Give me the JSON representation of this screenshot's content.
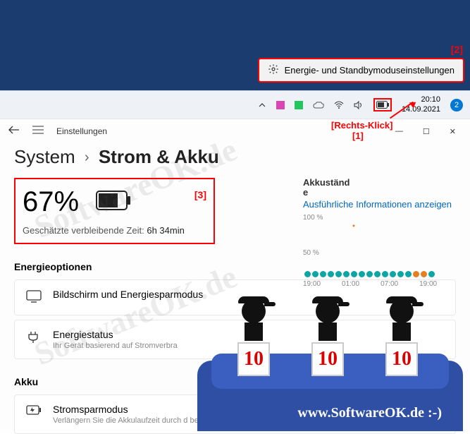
{
  "annotations": {
    "two": "[2]",
    "rightclick": "[Rechts-Klick]",
    "one": "[1]",
    "three": "[3]"
  },
  "context_menu": {
    "label": "Energie- und Standbymoduseinstellungen"
  },
  "taskbar": {
    "time": "20:10",
    "date": "14.09.2021",
    "badge": "2"
  },
  "settings": {
    "app_name": "Einstellungen",
    "breadcrumb_root": "System",
    "breadcrumb_current": "Strom & Akku"
  },
  "battery": {
    "percent": "67%",
    "remaining_label": "Geschätzte verbleibende Zeit:",
    "remaining_value": "6h 34min"
  },
  "levels": {
    "label": "Akkuständ\ne",
    "link": "Ausführliche Informationen anzeigen",
    "tick100": "100 %",
    "tick50": "50 %",
    "times": [
      "19:00",
      "01:00",
      "07:00",
      "19:00"
    ]
  },
  "sections": {
    "energy": "Energieoptionen",
    "akku": "Akku"
  },
  "options": {
    "screen": {
      "title": "Bildschirm und Energiesparmodus"
    },
    "status": {
      "title": "Energiestatus",
      "sub": "Ihr Gerät basierend auf Stromverbra"
    },
    "saver": {
      "title": "Stromsparmodus",
      "sub": "Verlängern Sie die Akkulaufzeit durch d\nbestimmten Benachrichtigungen und H"
    }
  },
  "overlay": {
    "watermark": "SoftwareOK.de",
    "score": "10",
    "url": "www.SoftwareOK.de :-)"
  }
}
